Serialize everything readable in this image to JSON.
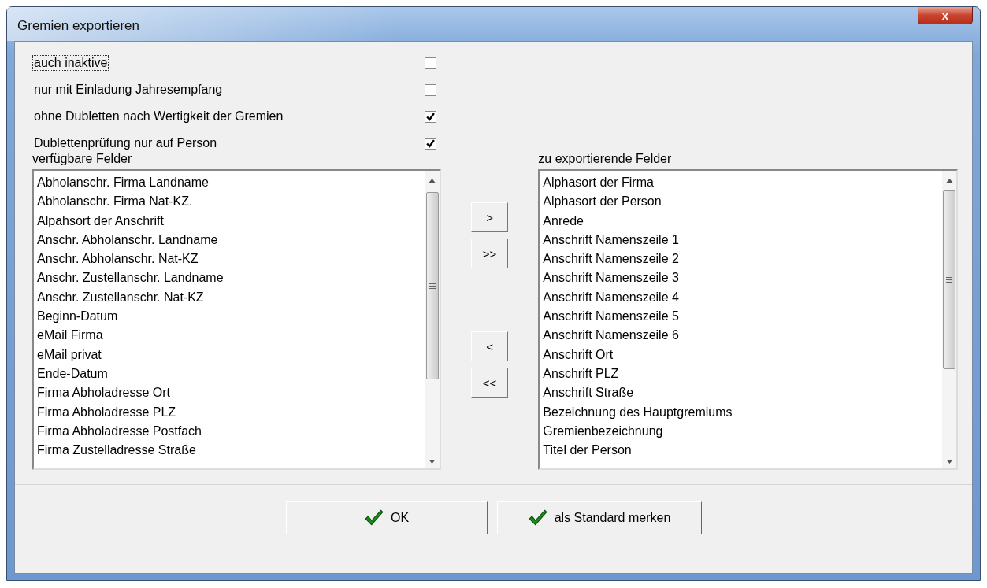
{
  "window": {
    "title": "Gremien exportieren",
    "close": "x"
  },
  "options": [
    {
      "label": "auch inaktive",
      "checked": false,
      "focused": true
    },
    {
      "label": "nur mit Einladung Jahresempfang",
      "checked": false,
      "focused": false
    },
    {
      "label": "ohne Dubletten nach Wertigkeit der Gremien",
      "checked": true,
      "focused": false
    },
    {
      "label": "Dublettenprüfung nur auf Person",
      "checked": true,
      "focused": false
    }
  ],
  "available": {
    "label": "verfügbare Felder",
    "items": [
      "Abholanschr. Firma Landname",
      "Abholanschr. Firma Nat-KZ.",
      "Alpahsort der Anschrift",
      "Anschr. Abholanschr. Landname",
      "Anschr. Abholanschr. Nat-KZ",
      "Anschr. Zustellanschr. Landname",
      "Anschr. Zustellanschr. Nat-KZ",
      "Beginn-Datum",
      "eMail Firma",
      "eMail privat",
      "Ende-Datum",
      "Firma Abholadresse Ort",
      "Firma Abholadresse PLZ",
      "Firma Abholadresse Postfach",
      "Firma Zustelladresse Straße"
    ]
  },
  "move_buttons": [
    ">",
    ">>",
    "<",
    "<<"
  ],
  "selected_fields": {
    "label": "zu exportierende Felder",
    "items": [
      "Alphasort der Firma",
      "Alphasort der Person",
      "Anrede",
      "Anschrift Namenszeile 1",
      "Anschrift Namenszeile 2",
      "Anschrift Namenszeile 3",
      "Anschrift Namenszeile 4",
      "Anschrift Namenszeile 5",
      "Anschrift Namenszeile 6",
      "Anschrift Ort",
      "Anschrift PLZ",
      "Anschrift Straße",
      "Bezeichnung des Hauptgremiums",
      "Gremienbezeichnung",
      "Titel der Person"
    ]
  },
  "buttons": [
    "OK",
    "als Standard merken"
  ]
}
